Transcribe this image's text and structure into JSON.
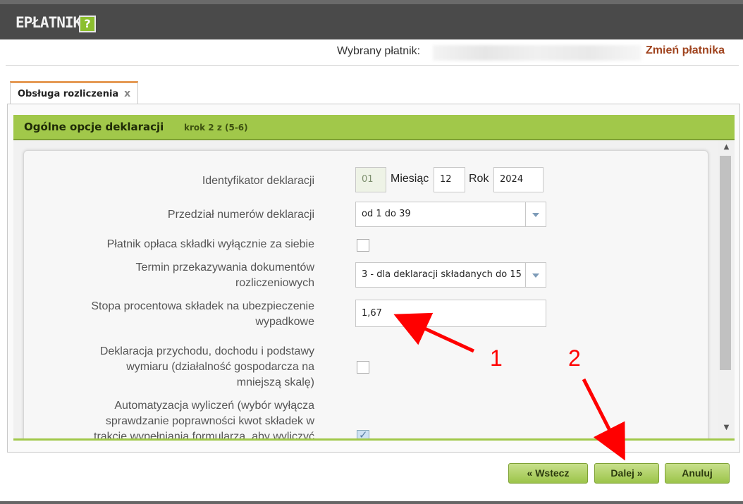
{
  "header": {
    "title": "EPŁATNIK",
    "help_icon": "?"
  },
  "payer": {
    "label": "Wybrany płatnik:",
    "change_link": "Zmień płatnika"
  },
  "tab": {
    "label": "Obsługa rozliczenia",
    "close_icon": "x"
  },
  "section": {
    "title": "Ogólne opcje deklaracji",
    "step": "krok 2 z (5-6)"
  },
  "form": {
    "identifier": {
      "label": "Identyfikator deklaracji",
      "value": "01",
      "month_label": "Miesiąc",
      "month": "12",
      "year_label": "Rok",
      "year": "2024"
    },
    "range": {
      "label": "Przedział numerów deklaracji",
      "value": "od 1 do 39"
    },
    "self_only": {
      "label": "Płatnik opłaca składki wyłącznie za siebie",
      "checked": false
    },
    "deadline": {
      "label_line1": "Termin przekazywania dokumentów",
      "label_line2": "rozliczeniowych",
      "value": "3 - dla deklaracji składanych do 15"
    },
    "accident_rate": {
      "label_line1": "Stopa procentowa składek na ubezpieczenie",
      "label_line2": "wypadkowe",
      "value": "1,67"
    },
    "income_decl": {
      "label_line1": "Deklaracja przychodu, dochodu i podstawy",
      "label_line2": "wymiaru (działalność gospodarcza na",
      "label_line3": "mniejszą skalę)",
      "checked": false
    },
    "automation": {
      "label_line1": "Automatyzacja wyliczeń (wybór wyłącza",
      "label_line2": "sprawdzanie poprawności kwot składek w",
      "label_line3": "trakcie wypełniania formularza, aby wyliczyć",
      "checked": true
    }
  },
  "buttons": {
    "back": "« Wstecz",
    "next": "Dalej »",
    "cancel": "Anuluj"
  },
  "annotations": {
    "one": "1",
    "two": "2",
    "color": "#ff0000"
  }
}
